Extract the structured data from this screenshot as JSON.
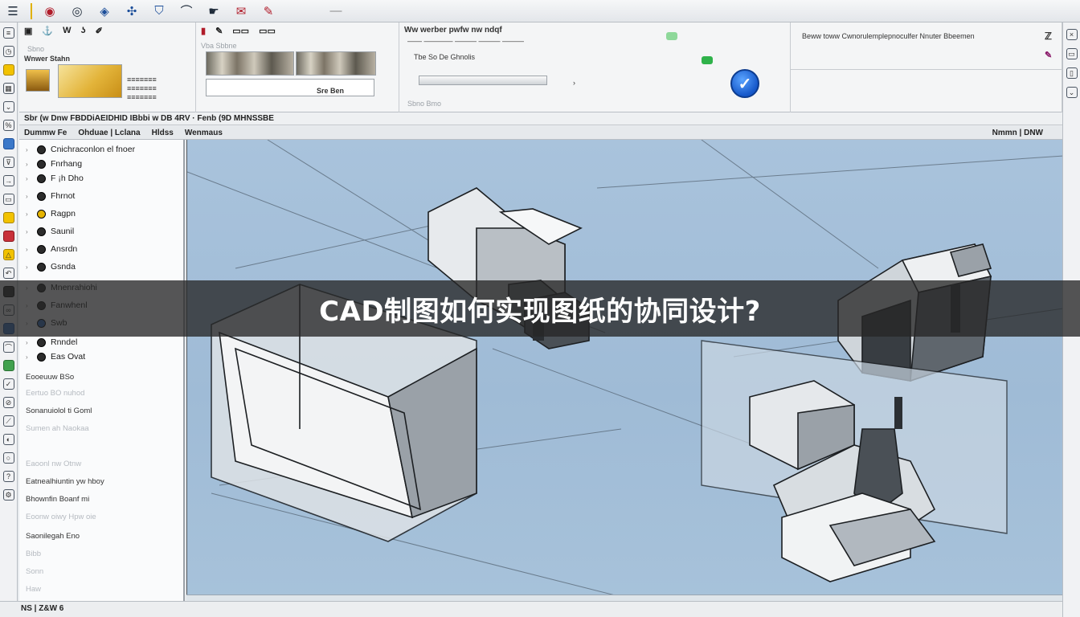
{
  "overlay": {
    "title": "CAD制图如何实现图纸的协同设计?"
  },
  "colors": {
    "viewport_bg": "#a9c3dc",
    "overlay_bg": "#262626",
    "accent_blue": "#1557c9",
    "accent_yellow": "#e0b100"
  },
  "toolbar": {
    "icons": [
      "menu-icon",
      "record-icon",
      "target-icon",
      "cube-icon",
      "network-icon",
      "shield-icon",
      "feather-icon",
      "hand-icon",
      "envelope-icon",
      "pencil-icon",
      "minimize-icon"
    ]
  },
  "ribbon": {
    "panel1_label": "Wnwer Stahn",
    "panel3_heading": "Ww werber pwfw nw ndqf",
    "panel3_sub": "Tbe So De Ghnolis",
    "panel4_text": "Beww toww Cwnorulemplepnoculfer Nnuter Bbeemen",
    "panel2_tag": "Sre Ben"
  },
  "crumbbar": {
    "text": "Sbr (w Dnw FBDDiAEIDHID IBbbi w DB 4RV · Fenb (9D MHNSSBE"
  },
  "panel_head": {
    "tabs": [
      "Dummw Fe",
      "Ohduae | Lclana",
      "Hldss",
      "Wenmaus"
    ],
    "right_label": "Nmmn | DNW"
  },
  "tree": {
    "items": [
      {
        "label": "Cnichraconlon el fnoer",
        "icon": "layer-icon"
      },
      {
        "label": "Fnrhang",
        "icon": "layer-icon"
      },
      {
        "label": "F ¡h Dho",
        "icon": "layer-icon"
      },
      {
        "label": "Fhrnot",
        "icon": "layer-icon"
      },
      {
        "label": "Ragpn",
        "icon": "layer-icon"
      },
      {
        "label": "Saunil",
        "icon": "layer-icon"
      },
      {
        "label": "Ansrdn",
        "icon": "layer-icon"
      },
      {
        "label": "Gsnda",
        "icon": "layer-icon"
      },
      {
        "label": "Mnenrahiohi",
        "icon": "layer-icon"
      },
      {
        "label": "Fanwhenl",
        "icon": "layer-icon"
      },
      {
        "label": "Swb",
        "icon": "layer-icon"
      },
      {
        "label": "Rnndel",
        "icon": "layer-icon"
      },
      {
        "label": "Eas Ovat",
        "icon": "layer-icon"
      }
    ],
    "props": [
      {
        "label": "Eooeuuw   BSo",
        "faint": false
      },
      {
        "label": "Eertuo   BO nuhod",
        "faint": true
      },
      {
        "label": "Sonanuiolol ti Goml",
        "faint": false
      },
      {
        "label": "Sumen ah   Naokaa",
        "faint": true
      },
      {
        "label": "Eaoonl nw   Otnw",
        "faint": true
      },
      {
        "label": "Eatnealhiuntin yw hboy",
        "faint": false
      },
      {
        "label": "Bhownfin Boanf mi",
        "faint": false
      },
      {
        "label": "Eoonw oiwy   Hpw oie",
        "faint": true
      },
      {
        "label": "Saonilegah Eno",
        "faint": false
      },
      {
        "label": "Bibb",
        "faint": true
      },
      {
        "label": "Sonn",
        "faint": true
      },
      {
        "label": "Haw",
        "faint": true
      }
    ]
  },
  "bottombar": {
    "text": "NS | Z&W   6"
  }
}
